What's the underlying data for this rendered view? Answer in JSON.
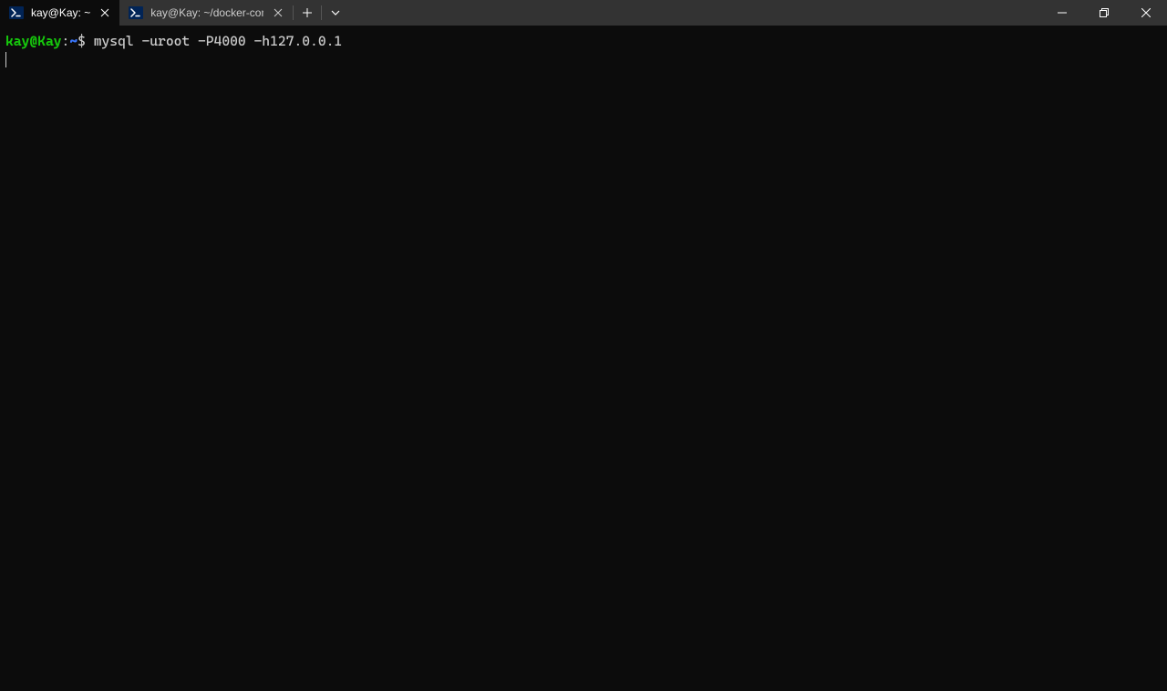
{
  "tabs": [
    {
      "title": "kay@Kay: ~",
      "active": true
    },
    {
      "title": "kay@Kay: ~/docker-configs/ha",
      "active": false
    }
  ],
  "prompt": {
    "user": "kay@Kay",
    "separator": ":",
    "path": "~",
    "sigil": "$"
  },
  "command": "mysql -uroot -P4000 -h127.0.0.1"
}
